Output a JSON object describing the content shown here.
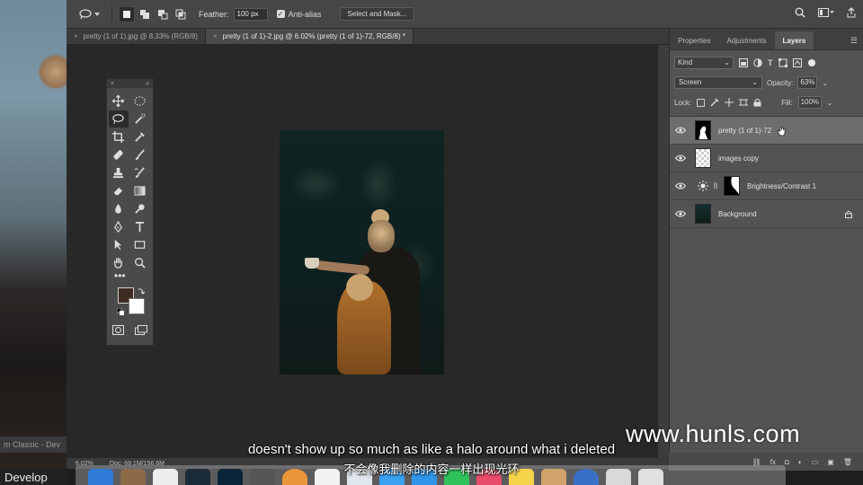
{
  "background": {
    "left_label": "m Classic - Dev",
    "develop_label": "Develop"
  },
  "options_bar": {
    "feather_label": "Feather:",
    "feather_value": "100 px",
    "antialias_label": "Anti-alias",
    "select_mask_label": "Select and Mask..."
  },
  "tabs": [
    {
      "label": "pretty (1 of 1).jpg @ 8.33% (RGB/8)"
    },
    {
      "label": "pretty (1 of 1)-2.jpg @ 6.02% (pretty (1 of 1)-72, RGB/8) *"
    }
  ],
  "panel_tabs": [
    {
      "label": "Properties"
    },
    {
      "label": "Adjustments"
    },
    {
      "label": "Layers"
    }
  ],
  "layers_panel": {
    "kind_label": "Kind",
    "blend_mode": "Screen",
    "opacity_label": "Opacity:",
    "opacity_value": "63%",
    "lock_label": "Lock:",
    "fill_label": "Fill:",
    "fill_value": "100%",
    "layers": [
      {
        "name": "pretty (1 of 1)-72"
      },
      {
        "name": "images copy"
      },
      {
        "name": "Brightness/Contrast 1"
      },
      {
        "name": "Background"
      }
    ]
  },
  "status": {
    "zoom": "6.02%",
    "doc": "Doc: 69.1M/156.6M"
  },
  "subtitles": {
    "english": "doesn't show up so much as like a halo around what i deleted",
    "chinese": "不会像我删除的内容一样出现光环"
  },
  "watermark": "www.hunls.com",
  "colors": {
    "foreground": "#3d2c22",
    "background": "#ffffff",
    "panel": "#535353"
  }
}
